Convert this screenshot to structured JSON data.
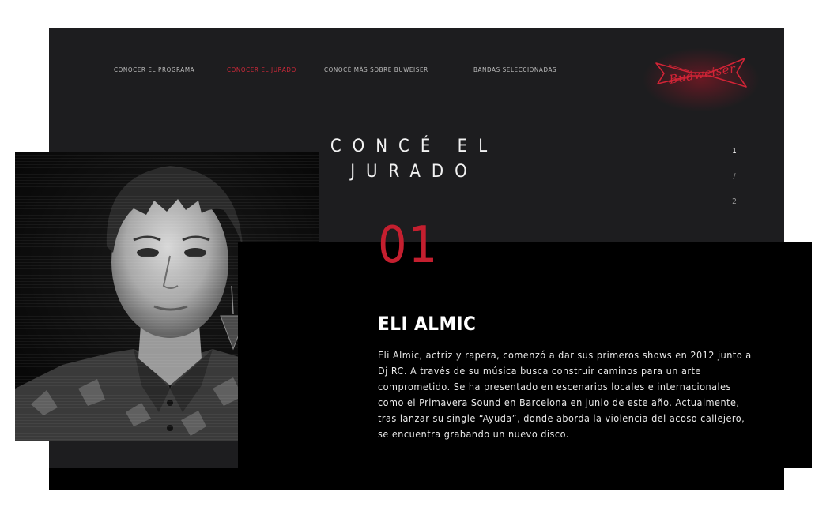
{
  "nav": {
    "items": [
      {
        "label": "CONOCER EL PROGRAMA"
      },
      {
        "label": "CONOCER EL JURADO",
        "active": true
      },
      {
        "label": "CONOCÉ MÁS SOBRE BUWEISER"
      },
      {
        "label": "BANDAS SELECCIONADAS"
      }
    ]
  },
  "brand": {
    "logo_text": "Budweiser",
    "accent_color": "#c41f2f"
  },
  "page": {
    "title": "CONCÉ EL JURADO"
  },
  "pager": {
    "current": "1",
    "separator": "/",
    "total": "2"
  },
  "juror": {
    "number": "01",
    "name": "ELI ALMIC",
    "bio": "Eli Almic, actriz y rapera, comenzó a dar sus primeros shows en 2012 junto a Dj RC. A través de su música busca construir caminos para un arte comprometido. Se ha presentado en escenarios locales e internacionales como el Primavera Sound en Barcelona en junio de este año. Actualmente, tras lanzar su single “Ayuda”, donde aborda la violencia del acoso callejero, se encuentra grabando un nuevo disco."
  }
}
